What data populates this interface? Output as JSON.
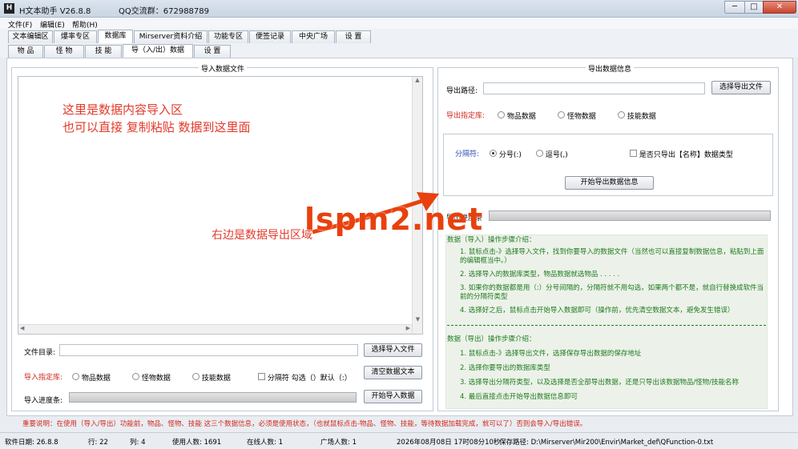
{
  "window": {
    "title": "H文本助手  V26.8.8",
    "qq": "QQ交流群：672988789",
    "min": "─",
    "max": "□",
    "close": "✕"
  },
  "menu": [
    "文件(F)",
    "编辑(E)",
    "帮助(H)"
  ],
  "tabs_main": [
    "文本编辑区",
    "爆率专区",
    "数据库",
    "Mirserver资料介绍",
    "功能专区",
    "便签记录",
    "中央广场",
    "设  置"
  ],
  "tabs_sub": [
    "物  品",
    "怪  物",
    "技  能",
    "导（入/出）数据",
    "设  置"
  ],
  "import": {
    "group_title": "导入数据文件",
    "overlay_line1": "这里是数据内容导入区",
    "overlay_line2": "也可以直接 复制粘贴 数据到这里面",
    "overlay_right": "右边是数据导出区域",
    "file_dir_label": "文件目录:",
    "select_file_btn": "选择导入文件",
    "db_label": "导入指定库:",
    "opt_item": "物品数据",
    "opt_monster": "怪物数据",
    "opt_skill": "技能数据",
    "separator_check": "分隔符 勾选（）默认（:）",
    "clear_btn": "清空数据文本",
    "progress_label": "导入进度条:",
    "start_btn": "开始导入数据"
  },
  "export": {
    "group_title": "导出数据信息",
    "path_label": "导出路径:",
    "select_file_btn": "选择导出文件",
    "db_label": "导出指定库:",
    "opt_item": "物品数据",
    "opt_monster": "怪物数据",
    "opt_skill": "技能数据",
    "separator_label": "分隔符:",
    "sep_colon": "分号(:)",
    "sep_comma": "逗号(,)",
    "name_only": "是否只导出【名称】数据类型",
    "start_btn": "开始导出数据信息",
    "progress_label": "导出进度条"
  },
  "instructions_import": {
    "title": "数据（导入）操作步骤介绍：",
    "steps": [
      "1. 鼠标点击-》选择导入文件，找到你要导入的数据文件（当然也可以直接复制数据信息，粘贴到上面的编辑框当中。）",
      "2. 选择导入的数据库类型，物品数据就选物品 . . . . .",
      "3. 如果你的数据都是用（:）分号间隔的，分隔符就不用勾选，如果两个都不是，就自行替换成软件当前的分隔符类型",
      "4. 选择好之后，鼠标点击开始导入数据即可（操作前，优先清空数据文本，避免发生错误）"
    ]
  },
  "instructions_export": {
    "title": "数据（导出）操作步骤介绍：",
    "steps": [
      "1. 鼠标点击-》选择导出文件，选择保存导出数据的保存地址",
      "2. 选择你要导出的数据库类型",
      "3. 选择导出分隔符类型，以及选择是否全部导出数据，还是只导出该数据物品/怪物/技能名称",
      "4. 最后直接点击开始导出数据信息即可"
    ]
  },
  "notice": "重要说明：在使用（导入/导出）功能前，物品、怪物、技能 这三个数据信息，必须是使用状态，（也就鼠标点击-物品、怪物、技能，等待数据加载完成，就可以了）否则会导入/导出错误。",
  "watermark": "lspm2.net",
  "status": {
    "date": "软件日期:  26.8.8",
    "row": "行: 22",
    "col": "列: 4",
    "users": "使用人数:  1691",
    "online": "在线人数:  1",
    "plaza": "广场人数:  1",
    "time": "2026年08月08日 17时08分10秒",
    "save_path": "保存路径:   D:\\Mirserver\\Mir200\\Envir\\Market_def\\QFunction-0.txt"
  },
  "colors": {
    "red": "#d2281c",
    "green": "#1f7a1f",
    "watermark": "#e8410e",
    "tab_active": "#ffffff"
  }
}
